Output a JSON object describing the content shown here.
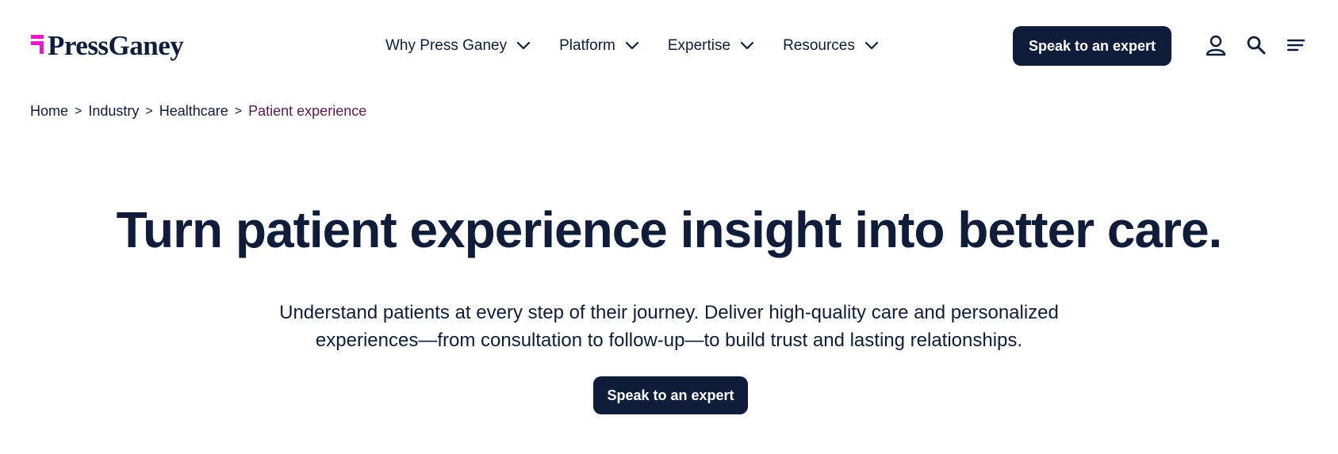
{
  "brand": {
    "logo_text": "PressGaney",
    "accent_color": "#e619c8",
    "navy_color": "#0f1d3a"
  },
  "nav": {
    "items": [
      {
        "label": "Why Press Ganey",
        "icon": "chevron-down-icon"
      },
      {
        "label": "Platform",
        "icon": "chevron-down-icon"
      },
      {
        "label": "Expertise",
        "icon": "chevron-down-icon"
      },
      {
        "label": "Resources",
        "icon": "chevron-down-icon"
      }
    ],
    "cta_label": "Speak to an expert",
    "icons": [
      "user-icon",
      "search-icon",
      "menu-icon"
    ]
  },
  "breadcrumb": {
    "items": [
      "Home",
      "Industry",
      "Healthcare",
      "Patient experience"
    ],
    "separator": ">"
  },
  "hero": {
    "title": "Turn patient experience insight into better care.",
    "subtitle": "Understand patients at every step of their journey. Deliver high-quality care and personalized experiences—from consultation to follow-up—to build trust and lasting relationships.",
    "cta_label": "Speak to an expert"
  }
}
